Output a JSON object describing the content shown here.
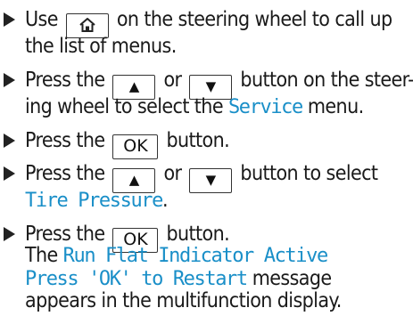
{
  "steps": [
    {
      "line1_a": "Use",
      "home_icon": "home-icon",
      "line1_b": "on the steering wheel to call up",
      "line2": "the list of menus."
    },
    {
      "line1_a": "Press the",
      "up_glyph": "▲",
      "line1_b": "or",
      "down_glyph": "▼",
      "line1_c": "button on the steer-",
      "line2_a": "ing wheel to select the",
      "menu_name": "Service",
      "line2_b": "menu."
    },
    {
      "line1_a": "Press the",
      "ok_label": "OK",
      "line1_b": "button."
    },
    {
      "line1_a": "Press the",
      "up_glyph": "▲",
      "line1_b": "or",
      "down_glyph": "▼",
      "line1_c": "button to select",
      "menu_name": "Tire Pressure",
      "line2_b": "."
    },
    {
      "line1_a": "Press the",
      "ok_label": "OK",
      "line1_b": "button.",
      "line2_a": "The",
      "msg_part1": "Run Flat Indicator Active",
      "msg_part2": "Press 'OK' to Restart",
      "line3_b": "message",
      "line4": "appears in the multifunction display."
    }
  ],
  "colors": {
    "display_text": "#1a8fc8",
    "body_text": "#1a1a1a"
  }
}
